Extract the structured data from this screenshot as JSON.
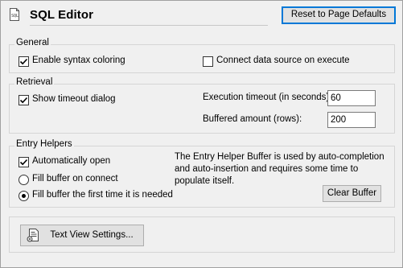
{
  "header": {
    "title": "SQL Editor",
    "reset_label": "Reset to Page Defaults"
  },
  "general": {
    "legend": "General",
    "syntax_coloring": {
      "label": "Enable syntax coloring",
      "checked": true
    },
    "connect_on_execute": {
      "label": "Connect data source on execute",
      "checked": false
    }
  },
  "retrieval": {
    "legend": "Retrieval",
    "show_timeout": {
      "label": "Show timeout dialog",
      "checked": true
    },
    "execution_timeout": {
      "label": "Execution timeout (in seconds):",
      "value": "60"
    },
    "buffered_amount": {
      "label": "Buffered amount (rows):",
      "value": "200"
    }
  },
  "entry_helpers": {
    "legend": "Entry Helpers",
    "auto_open": {
      "label": "Automatically open",
      "checked": true
    },
    "fill_on_connect": {
      "label": "Fill buffer on connect",
      "selected": false
    },
    "fill_first_time": {
      "label": "Fill buffer the first time it is needed",
      "selected": true
    },
    "note": "The Entry Helper Buffer is used by auto-completion and auto-insertion and requires some time to populate itself.",
    "clear_label": "Clear Buffer"
  },
  "text_view": {
    "button_label": "Text View Settings..."
  },
  "icons": {
    "title": "sql-file-icon",
    "text_view": "text-view-settings-icon",
    "check": "checkmark-icon"
  },
  "colors": {
    "background": "#f0f0f0",
    "button": "#e1e1e1",
    "focus_border": "#0078d7",
    "group_border": "#d5d5d5"
  }
}
